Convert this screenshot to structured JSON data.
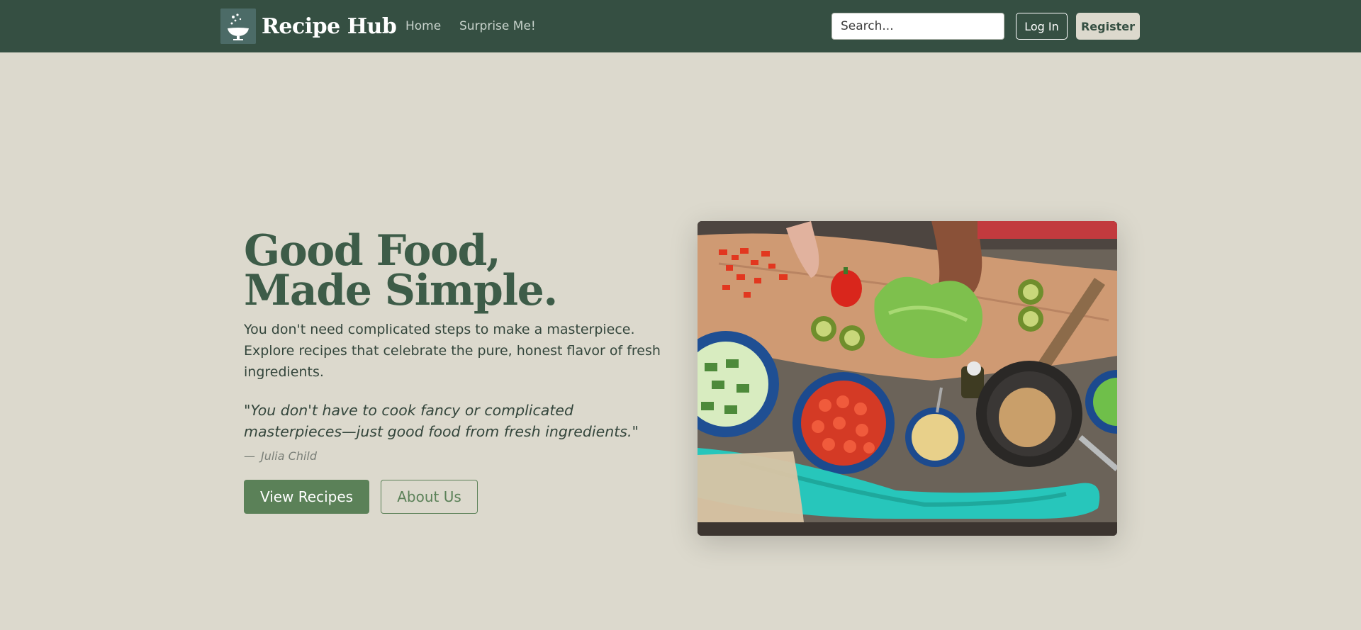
{
  "navbar": {
    "brand_name": "Recipe Hub",
    "brand_icon": "chef-pot-logo-icon",
    "links": [
      {
        "label": "Home"
      },
      {
        "label": "Surprise Me!"
      }
    ],
    "search_placeholder": "Search...",
    "login_label": "Log In",
    "register_label": "Register"
  },
  "hero": {
    "title": "Good Food, Made Simple.",
    "description": "You don't need complicated steps to make a masterpiece. Explore recipes that celebrate the pure, honest flavor of fresh ingredients.",
    "quote": "\"You don't have to cook fancy or complicated masterpieces—just good food from fresh ingredients.\"",
    "quote_dash": "—",
    "quote_author": "Julia Child",
    "primary_button": "View Recipes",
    "secondary_button": "About Us"
  },
  "colors": {
    "navbar_bg": "#354f42",
    "page_bg": "#dcd9cd",
    "title_green": "#3d5c48",
    "button_green": "#5b8158"
  }
}
